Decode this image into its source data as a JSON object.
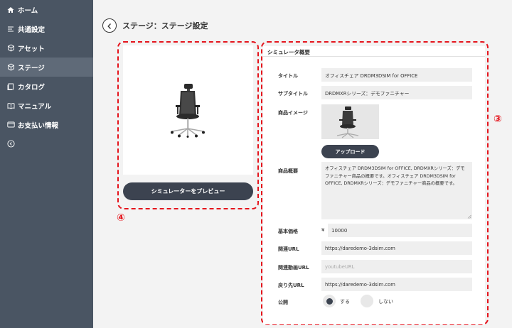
{
  "sidebar": {
    "items": [
      {
        "label": "ホーム",
        "icon": "home-icon"
      },
      {
        "label": "共通設定",
        "icon": "settings-list-icon"
      },
      {
        "label": "アセット",
        "icon": "asset-icon"
      },
      {
        "label": "ステージ",
        "icon": "stage-icon",
        "active": true
      },
      {
        "label": "カタログ",
        "icon": "catalog-icon"
      },
      {
        "label": "マニュアル",
        "icon": "manual-icon"
      },
      {
        "label": "お支払い情報",
        "icon": "payment-icon"
      }
    ],
    "collapse_icon": "chevron-left-circle-icon"
  },
  "header": {
    "title": "ステージ：ステージ設定"
  },
  "preview": {
    "button_label": "シミュレーターをプレビュー",
    "badge": "④"
  },
  "form": {
    "badge": "③",
    "section_title": "シミュレータ概要",
    "title_label": "タイトル",
    "title_value": "オフィスチェア DRDM3DSIM for OFFICE",
    "subtitle_label": "サブタイトル",
    "subtitle_value": "DRDMXRシリーズ：デモファニチャー",
    "image_label": "商品イメージ",
    "upload_label": "アップロード",
    "desc_label": "商品概要",
    "desc_value": "オフィスチェア DRDM3DSIM for OFFICE, DRDMXRシリーズ：デモファニチャー商品の概要です。オフィスチェア DRDM3DSIM for OFFICE, DRDMXRシリーズ：デモファニチャー商品の概要です。",
    "price_label": "基本価格",
    "price_currency": "¥",
    "price_value": "10000",
    "url_label": "関連URL",
    "url_value": "https://daredemo-3dsim.com",
    "video_label": "関連動画URL",
    "video_placeholder": "youtubeURL",
    "return_label": "戻り先URL",
    "return_value": "https://daredemo-3dsim.com",
    "publish_label": "公開",
    "publish_yes": "する",
    "publish_no": "しない",
    "publish_selected": "する"
  },
  "colors": {
    "sidebar_bg": "#4a5563",
    "sidebar_active": "#5f6a78",
    "button_dark": "#3c4350",
    "annotation_red": "#e5141c"
  }
}
